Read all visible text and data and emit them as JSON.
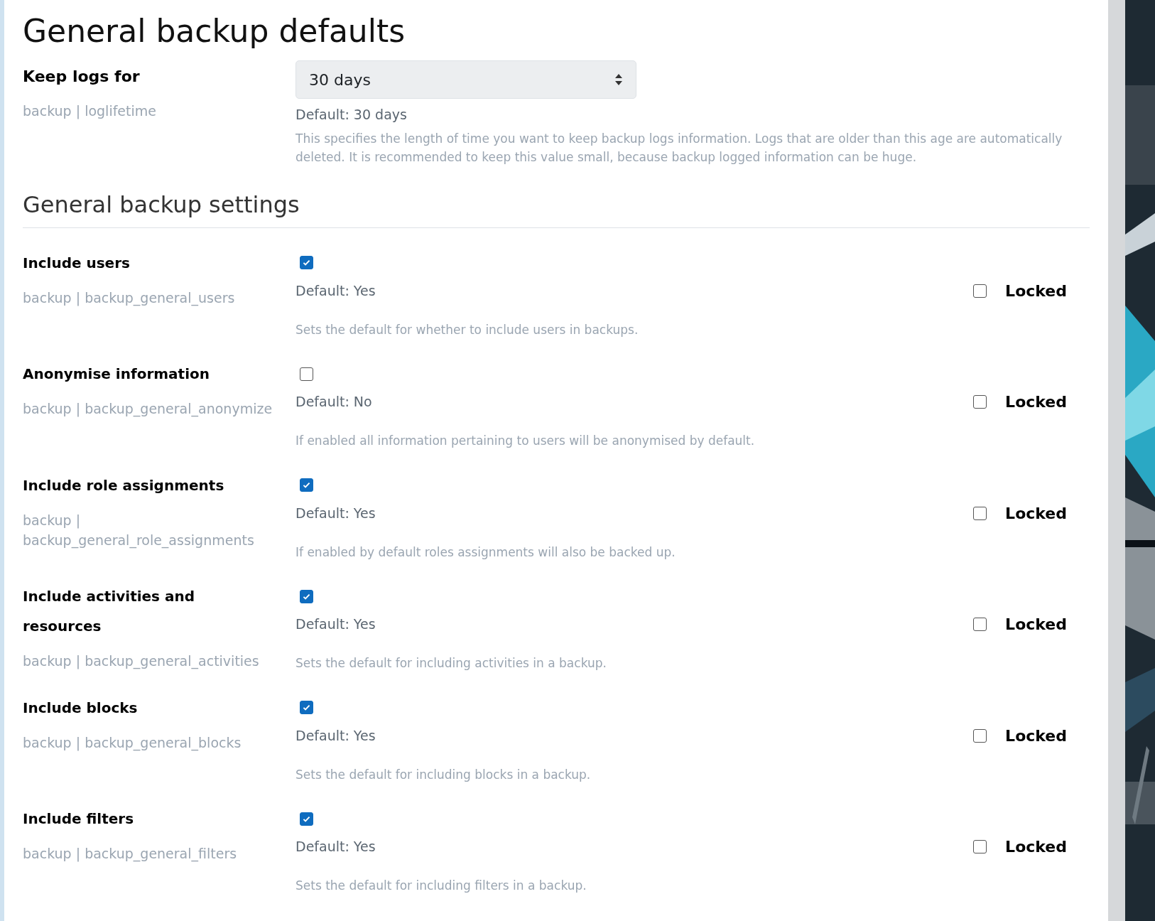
{
  "heading": "General backup defaults",
  "keep_logs": {
    "label": "Keep logs for",
    "setting_name": "backup | loglifetime",
    "value": "30 days",
    "default": "Default: 30 days",
    "description": "This specifies the length of time you want to keep backup logs information. Logs that are older than this age are automatically deleted. It is recommended to keep this value small, because backup logged information can be huge."
  },
  "section_title": "General backup settings",
  "settings": [
    {
      "label": "Include users",
      "setting_name": "backup | backup_general_users",
      "checked": true,
      "default": "Default: Yes",
      "locked_label": "Locked",
      "locked": false,
      "description": "Sets the default for whether to include users in backups."
    },
    {
      "label": "Anonymise information",
      "setting_name": "backup | backup_general_anonymize",
      "checked": false,
      "default": "Default: No",
      "locked_label": "Locked",
      "locked": false,
      "description": "If enabled all information pertaining to users will be anonymised by default."
    },
    {
      "label": "Include role assignments",
      "setting_name": "backup | backup_general_role_assignments",
      "checked": true,
      "default": "Default: Yes",
      "locked_label": "Locked",
      "locked": false,
      "description": "If enabled by default roles assignments will also be backed up."
    },
    {
      "label": "Include activities and resources",
      "setting_name": "backup | backup_general_activities",
      "checked": true,
      "default": "Default: Yes",
      "locked_label": "Locked",
      "locked": false,
      "description": "Sets the default for including activities in a backup."
    },
    {
      "label": "Include blocks",
      "setting_name": "backup | backup_general_blocks",
      "checked": true,
      "default": "Default: Yes",
      "locked_label": "Locked",
      "locked": false,
      "description": "Sets the default for including blocks in a backup."
    },
    {
      "label": "Include filters",
      "setting_name": "backup | backup_general_filters",
      "checked": true,
      "default": "Default: Yes",
      "locked_label": "Locked",
      "locked": false,
      "description": "Sets the default for including filters in a backup."
    }
  ]
}
